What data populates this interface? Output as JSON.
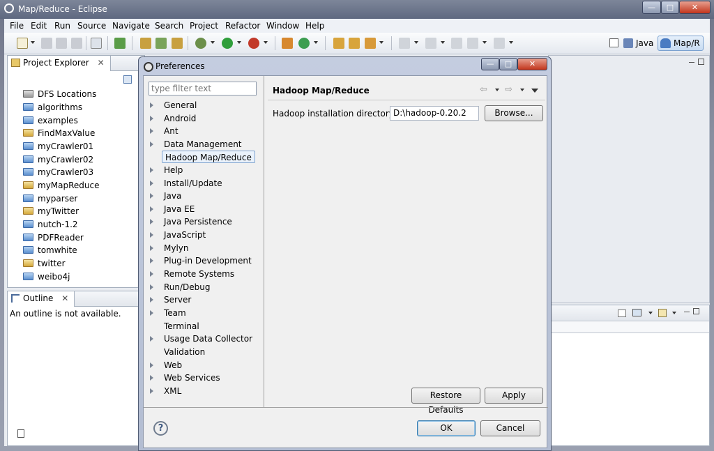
{
  "window": {
    "title": "Map/Reduce - Eclipse",
    "min": "—",
    "max": "□",
    "close": "✕"
  },
  "menu": [
    "File",
    "Edit",
    "Run",
    "Source",
    "Navigate",
    "Search",
    "Project",
    "Refactor",
    "Window",
    "Help"
  ],
  "perspectives": {
    "java": "Java",
    "mapreduce": "Map/R"
  },
  "project_explorer": {
    "tab": "Project Explorer",
    "items": [
      "DFS Locations",
      "algorithms",
      "examples",
      "FindMaxValue",
      "myCrawler01",
      "myCrawler02",
      "myCrawler03",
      "myMapReduce",
      "myparser",
      "myTwitter",
      "nutch-1.2",
      "PDFReader",
      "tomwhite",
      "twitter",
      "weibo4j"
    ]
  },
  "outline": {
    "tab": "Outline",
    "message": "An outline is not available."
  },
  "dialog": {
    "title": "Preferences",
    "filter_placeholder": "type filter text",
    "items": [
      "General",
      "Android",
      "Ant",
      "Data Management",
      "Hadoop Map/Reduce",
      "Help",
      "Install/Update",
      "Java",
      "Java EE",
      "Java Persistence",
      "JavaScript",
      "Mylyn",
      "Plug-in Development",
      "Remote Systems",
      "Run/Debug",
      "Server",
      "Team",
      "Terminal",
      "Usage Data Collector",
      "Validation",
      "Web",
      "Web Services",
      "XML"
    ],
    "page_title": "Hadoop Map/Reduce",
    "field_label": "Hadoop installation directory:",
    "field_value": "D:\\hadoop-0.20.2",
    "browse": "Browse...",
    "restore": "Restore Defaults",
    "apply": "Apply",
    "ok": "OK",
    "cancel": "Cancel",
    "help": "?"
  },
  "colors": {
    "accent": "#3399ff",
    "selection": "#eaf2fb"
  }
}
